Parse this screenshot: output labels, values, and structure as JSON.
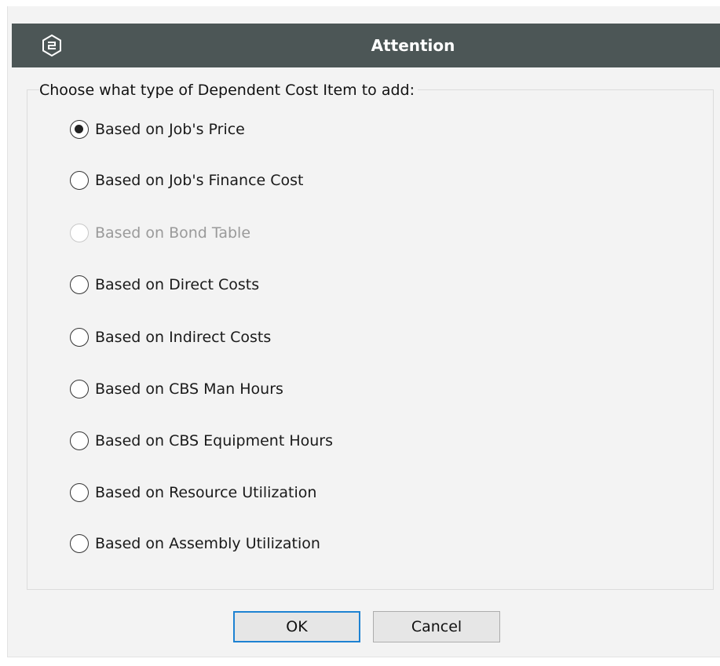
{
  "dialog": {
    "title": "Attention",
    "logo_icon": "app-logo-icon"
  },
  "group": {
    "legend": "Choose what type of Dependent Cost Item to add:",
    "options": [
      {
        "label": "Based on Job's Price",
        "checked": true,
        "disabled": false
      },
      {
        "label": "Based on Job's Finance Cost",
        "checked": false,
        "disabled": false
      },
      {
        "label": "Based on Bond Table",
        "checked": false,
        "disabled": true
      },
      {
        "label": "Based on Direct Costs",
        "checked": false,
        "disabled": false
      },
      {
        "label": "Based on Indirect Costs",
        "checked": false,
        "disabled": false
      },
      {
        "label": "Based on CBS Man Hours",
        "checked": false,
        "disabled": false
      },
      {
        "label": "Based on CBS Equipment Hours",
        "checked": false,
        "disabled": false
      },
      {
        "label": "Based on Resource Utilization",
        "checked": false,
        "disabled": false
      },
      {
        "label": "Based on Assembly Utilization",
        "checked": false,
        "disabled": false
      }
    ]
  },
  "buttons": {
    "ok_label": "OK",
    "cancel_label": "Cancel"
  },
  "colors": {
    "titlebar": "#4c5656",
    "default_button_border": "#1e82d2",
    "dialog_background": "#f3f3f3"
  }
}
